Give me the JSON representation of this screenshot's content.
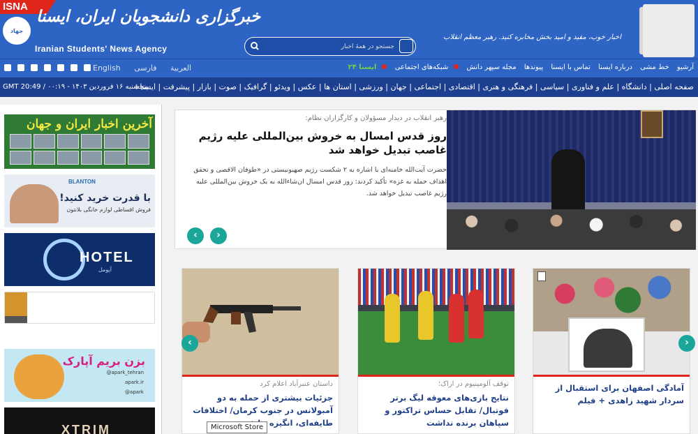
{
  "header": {
    "isna_tag": "ISNA",
    "emblem_text": "جهاد",
    "logo_fa": "خبرگزاری دانشجویان ایران، ایسنا",
    "logo_en": "Iranian Students' News Agency",
    "search_placeholder": "جستجو در همهٔ اخبار",
    "slogan": "اخبار خوب، مفید و امید بخش مخابره کنید. رهبر معظم انقلاب"
  },
  "topnav": {
    "items": [
      "آرشیو",
      "خط مشی",
      "درباره ایسنا",
      "تماس با ایسنا",
      "پیوندها",
      "مجله سپهر دانش",
      "شبکه‌های اجتماعی",
      "ایسنا ۲۴"
    ],
    "languages": [
      "English",
      "العربية",
      "فارسی"
    ],
    "social_icons": [
      "windows-icon",
      "rss-icon",
      "instagram-icon",
      "twitter-icon",
      "android-icon",
      "apple-icon",
      "tv-icon"
    ]
  },
  "catnav": {
    "items": "صفحه اصلی | دانشگاه | علم و فناوری | سیاسی | فرهنگی و هنری | اقتصادی | اجتماعی | جهان | ورزشی | استان ها | عکس | ویدئو | گرافیک | صوت | بازار | پیشرفت | ایسنا+",
    "date": "GMT 20:49 / ۰۰:۱۹ - پنجشنبه ۱۶ فروردین ۱۴۰۳"
  },
  "sidebar": {
    "ad1_title": "آخرین اخبار ایران و جهان",
    "ad2_brand": "BLANTON",
    "ad2_big": "با قدرت خرید کنید!",
    "ad2_sub": "فروش اقساطی لوازم خانگی بلانتون",
    "ad3_text": "HOTEL",
    "ad3_sub": "آپومل",
    "ad5_title": "بزن بریم آپارک",
    "ad5_l1": "@apark_tehran",
    "ad5_l2": "apark.ir",
    "ad5_l3": "@apark",
    "ad6_text": "XTRIM"
  },
  "featured": {
    "kicker": "رهبر انقلاب در دیدار مسؤولان و کارگزاران نظام:",
    "headline": "روز قدس امسال به خروش بین‌المللی علیه رژیم غاصب تبدیل خواهد شد",
    "lead": "حضرت آیت‌الله خامنه‌ای با اشاره به ۲ شکست رژیم صهیونیستی در «طوفان الاقصی و تحقق اهداف حمله به غزه» تأکید کردند: روز قدس امسال ان‌شاءالله به یک خروش بین‌المللی علیه رژیم غاصب تبدیل خواهد شد.",
    "prev_label": "‹",
    "next_label": "›"
  },
  "cards": [
    {
      "kicker": "داستان عنبرآباد اعلام کرد",
      "title": "جزئیات بیشتری از حمله به دو آمبولانس در جنوب کرمان/ اختلافات طایفه‌ای، انگیزه حادثه"
    },
    {
      "kicker": "توقف آلومینیوم در اراک؛",
      "title": "نتایج بازی‌های معوقه لیگ برتر فوتبال/ تقابل حساس تراکتور و سپاهان برنده نداشت"
    },
    {
      "kicker": "",
      "title": "آمادگی اصفهان برای استقبال از سردار شهید زاهدی + فیلم"
    }
  ],
  "tooltip": "Microsoft Store",
  "colors": {
    "header_blue": "#2e64c4",
    "nav_dark": "#1d3f8f",
    "accent_red": "#e0251b",
    "teal": "#1ba69a",
    "title_blue": "#1f3f86",
    "tv_green": "#6ed24a"
  }
}
